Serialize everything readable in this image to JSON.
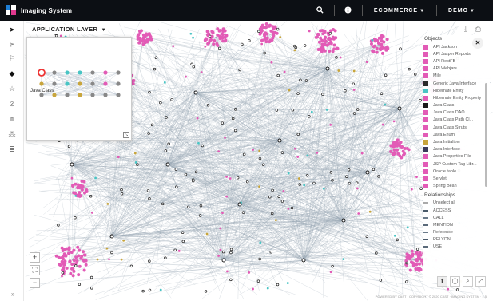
{
  "header": {
    "app_title": "Imaging System",
    "menus": [
      {
        "label": "ECOMMERCE"
      },
      {
        "label": "DEMO"
      }
    ],
    "brand_colors": [
      "#1e7fd6",
      "#e0398f",
      "#ffffff"
    ]
  },
  "graph": {
    "layer_selector": "APPLICATION LAYER",
    "minimap_caption": "Java Class"
  },
  "legend": {
    "objects_title": "Objects",
    "objects": [
      {
        "label": "API Jackson",
        "color": "#e25bb6"
      },
      {
        "label": "API Jasper Reports",
        "color": "#e25bb6"
      },
      {
        "label": "API RestFB",
        "color": "#e25bb6"
      },
      {
        "label": "API Webjars",
        "color": "#e25bb6"
      },
      {
        "label": "Mile",
        "color": "#e25bb6"
      },
      {
        "label": "Generic Java Interface",
        "color": "#2c2c2c"
      },
      {
        "label": "Hibernate Entity",
        "color": "#48c4c4"
      },
      {
        "label": "Hibernate Entity Property",
        "color": "#e25bb6"
      },
      {
        "label": "Java Class",
        "color": "#1a1a1a"
      },
      {
        "label": "Java Class DAO",
        "color": "#e25bb6"
      },
      {
        "label": "Java Class Path Cl...",
        "color": "#e25bb6"
      },
      {
        "label": "Java Class Struts",
        "color": "#e25bb6"
      },
      {
        "label": "Java Enum",
        "color": "#e25bb6"
      },
      {
        "label": "Java Initializer",
        "color": "#c8a53c"
      },
      {
        "label": "Java Interface",
        "color": "#3a3a5a"
      },
      {
        "label": "Java Properties File",
        "color": "#e25bb6"
      },
      {
        "label": "JSP Custom Tag Libr...",
        "color": "#e25bb6"
      },
      {
        "label": "Oracle table",
        "color": "#e25bb6"
      },
      {
        "label": "Servlet",
        "color": "#e25bb6"
      },
      {
        "label": "Spring Bean",
        "color": "#e25bb6"
      }
    ],
    "relations_title": "Relationships",
    "relations": [
      {
        "label": "Unselect all",
        "color": "#aaaaaa"
      },
      {
        "label": "ACCESS",
        "color": "#4a5a6a"
      },
      {
        "label": "CALL",
        "color": "#6a7a8a"
      },
      {
        "label": "MENTION",
        "color": "#5a6a7a"
      },
      {
        "label": "Reference",
        "color": "#6a7a8a"
      },
      {
        "label": "RELYON",
        "color": "#4a5a6a"
      },
      {
        "label": "USE",
        "color": "#5a6a7a"
      }
    ]
  },
  "footer": {
    "text": "POWERED BY CAST  ·  COPYRIGHT © 2020 CAST  ·  IMAGING SYSTEM  ·  1.5"
  }
}
